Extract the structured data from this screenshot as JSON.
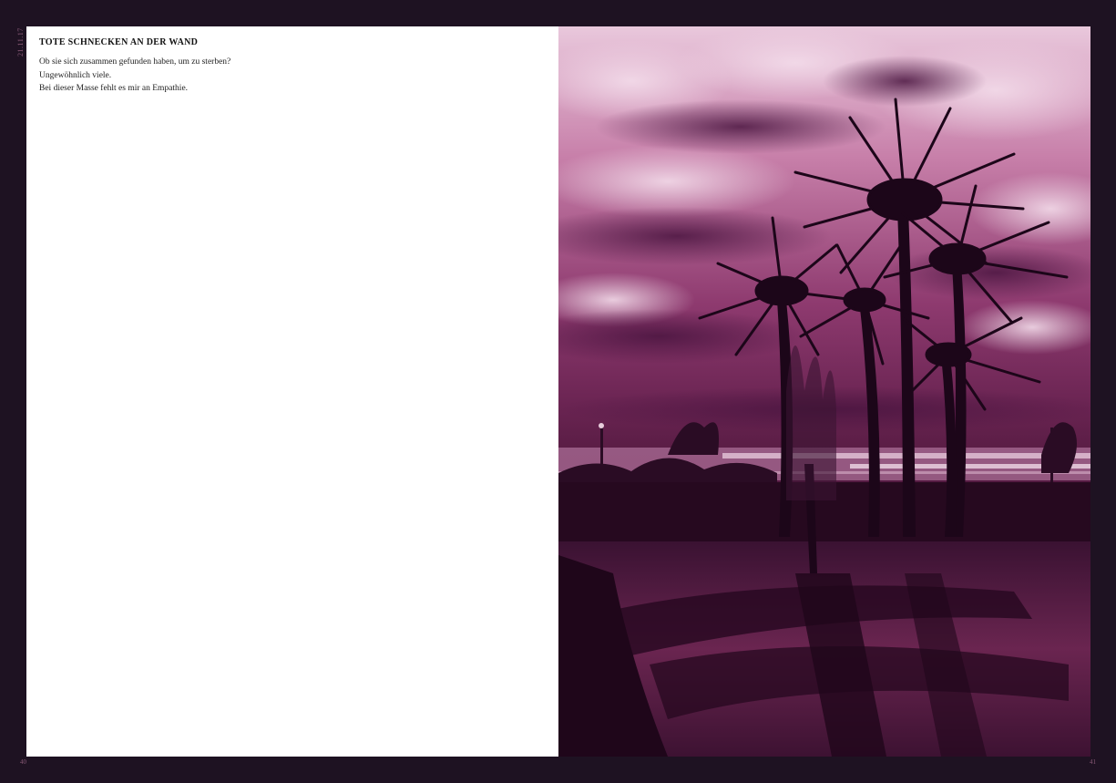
{
  "date": "21.11.17",
  "title": "TOTE SCHNECKEN AN DER WAND",
  "lines": [
    "Ob sie sich zusammen gefunden haben, um zu sterben?",
    "Ungewöhnlich viele.",
    "Bei dieser Masse fehlt es mir an Empathie."
  ],
  "page_numbers": {
    "left": "40",
    "right": "41"
  },
  "photo": {
    "subject": "palm-tree-silhouettes-at-dusk",
    "tint": "#7a2458",
    "sky_light": "#d8a6c6",
    "shadow": "#240a1e"
  }
}
